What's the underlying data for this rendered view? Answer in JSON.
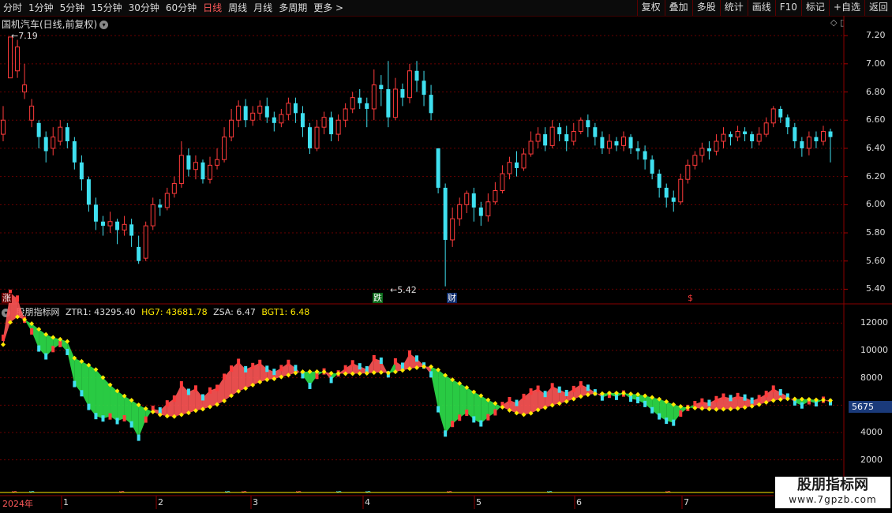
{
  "toolbar": {
    "left": [
      "分时",
      "1分钟",
      "5分钟",
      "15分钟",
      "30分钟",
      "60分钟",
      "日线",
      "周线",
      "月线",
      "多周期",
      "更多 >"
    ],
    "active_index": 6,
    "right": [
      "复权",
      "叠加",
      "多股",
      "统计",
      "画线",
      "F10",
      "标记",
      "+自选",
      "返回"
    ]
  },
  "chart": {
    "title": "国机汽车(日线,前复权)",
    "high_label": "7.19",
    "low_label": "5.42",
    "price_axis": [
      "7.20",
      "7.00",
      "6.80",
      "6.60",
      "6.40",
      "6.20",
      "6.00",
      "5.80",
      "5.60",
      "5.40"
    ],
    "markers": {
      "rise": "涨",
      "fall": "跌",
      "finance": "财",
      "dollar": "$"
    }
  },
  "indicator": {
    "name": "股朋指标网",
    "ztr1": "ZTR1: 43295.40",
    "hg7": "HG7: 43681.78",
    "zsa": "ZSA: 6.47",
    "bgt1": "BGT1: 6.48",
    "axis": [
      "12000",
      "10000",
      "8000",
      "6000",
      "4000",
      "2000"
    ],
    "current_value": "5675"
  },
  "dates": {
    "year": "2024年",
    "months": [
      "1",
      "2",
      "3",
      "4",
      "5",
      "6",
      "7"
    ]
  },
  "watermark": {
    "line1": "股朋指标网",
    "line2": "www.7gpzb.com"
  },
  "colors": {
    "up": "#ff3b3b",
    "down": "#3fe0f0",
    "yellow": "#ffea00",
    "green": "#2ee04a",
    "grid": "#7a0000"
  },
  "chart_data": {
    "type": "candlestick",
    "y_range": [
      5.38,
      7.24
    ],
    "candles": [
      [
        6.5,
        6.6,
        6.45,
        6.7
      ],
      [
        6.9,
        7.19,
        6.9,
        7.15
      ],
      [
        6.95,
        7.12,
        6.9,
        7.17
      ],
      [
        6.8,
        6.85,
        6.75,
        7.0
      ],
      [
        6.6,
        6.7,
        6.55,
        6.75
      ],
      [
        6.58,
        6.48,
        6.4,
        6.6
      ],
      [
        6.48,
        6.38,
        6.3,
        6.52
      ],
      [
        6.4,
        6.48,
        6.35,
        6.55
      ],
      [
        6.45,
        6.55,
        6.42,
        6.6
      ],
      [
        6.55,
        6.45,
        6.4,
        6.58
      ],
      [
        6.45,
        6.3,
        6.25,
        6.48
      ],
      [
        6.3,
        6.18,
        6.1,
        6.35
      ],
      [
        6.18,
        6.0,
        5.95,
        6.2
      ],
      [
        6.0,
        5.88,
        5.82,
        6.05
      ],
      [
        5.88,
        5.85,
        5.78,
        5.92
      ],
      [
        5.85,
        5.88,
        5.8,
        5.95
      ],
      [
        5.88,
        5.82,
        5.72,
        5.9
      ],
      [
        5.82,
        5.86,
        5.78,
        5.92
      ],
      [
        5.86,
        5.78,
        5.7,
        5.9
      ],
      [
        5.7,
        5.6,
        5.58,
        5.78
      ],
      [
        5.62,
        5.85,
        5.6,
        5.88
      ],
      [
        5.85,
        6.0,
        5.82,
        6.05
      ],
      [
        6.0,
        5.98,
        5.92,
        6.04
      ],
      [
        5.98,
        6.08,
        5.96,
        6.12
      ],
      [
        6.08,
        6.15,
        6.05,
        6.2
      ],
      [
        6.15,
        6.35,
        6.12,
        6.45
      ],
      [
        6.35,
        6.25,
        6.2,
        6.4
      ],
      [
        6.25,
        6.3,
        6.18,
        6.35
      ],
      [
        6.3,
        6.18,
        6.15,
        6.32
      ],
      [
        6.18,
        6.28,
        6.15,
        6.34
      ],
      [
        6.28,
        6.32,
        6.25,
        6.4
      ],
      [
        6.32,
        6.48,
        6.3,
        6.55
      ],
      [
        6.48,
        6.6,
        6.45,
        6.68
      ],
      [
        6.6,
        6.7,
        6.55,
        6.74
      ],
      [
        6.7,
        6.6,
        6.55,
        6.75
      ],
      [
        6.6,
        6.65,
        6.56,
        6.7
      ],
      [
        6.65,
        6.7,
        6.6,
        6.74
      ],
      [
        6.7,
        6.62,
        6.58,
        6.76
      ],
      [
        6.62,
        6.58,
        6.52,
        6.66
      ],
      [
        6.58,
        6.64,
        6.55,
        6.68
      ],
      [
        6.64,
        6.72,
        6.6,
        6.76
      ],
      [
        6.72,
        6.65,
        6.58,
        6.76
      ],
      [
        6.65,
        6.55,
        6.48,
        6.7
      ],
      [
        6.55,
        6.4,
        6.36,
        6.58
      ],
      [
        6.4,
        6.55,
        6.38,
        6.6
      ],
      [
        6.55,
        6.62,
        6.5,
        6.66
      ],
      [
        6.62,
        6.5,
        6.45,
        6.66
      ],
      [
        6.5,
        6.6,
        6.45,
        6.64
      ],
      [
        6.6,
        6.68,
        6.55,
        6.72
      ],
      [
        6.68,
        6.76,
        6.65,
        6.8
      ],
      [
        6.76,
        6.72,
        6.68,
        6.82
      ],
      [
        6.72,
        6.68,
        6.55,
        6.76
      ],
      [
        6.68,
        6.85,
        6.6,
        6.96
      ],
      [
        6.85,
        6.82,
        6.7,
        6.92
      ],
      [
        6.82,
        6.62,
        6.55,
        7.02
      ],
      [
        6.62,
        6.82,
        6.6,
        6.9
      ],
      [
        6.82,
        6.76,
        6.7,
        6.86
      ],
      [
        6.76,
        6.95,
        6.72,
        7.0
      ],
      [
        6.95,
        6.88,
        6.8,
        7.02
      ],
      [
        6.88,
        6.78,
        6.7,
        6.95
      ],
      [
        6.78,
        6.65,
        6.6,
        6.85
      ],
      [
        6.4,
        6.12,
        6.08,
        6.32
      ],
      [
        6.12,
        5.75,
        5.42,
        6.15
      ],
      [
        5.75,
        5.9,
        5.7,
        5.98
      ],
      [
        5.9,
        6.0,
        5.85,
        6.05
      ],
      [
        6.0,
        6.08,
        5.94,
        6.1
      ],
      [
        6.08,
        5.98,
        5.88,
        6.12
      ],
      [
        5.98,
        5.92,
        5.85,
        6.02
      ],
      [
        5.92,
        6.02,
        5.88,
        6.08
      ],
      [
        6.02,
        6.1,
        6.0,
        6.16
      ],
      [
        6.1,
        6.22,
        6.08,
        6.28
      ],
      [
        6.22,
        6.3,
        6.18,
        6.34
      ],
      [
        6.3,
        6.26,
        6.2,
        6.38
      ],
      [
        6.26,
        6.36,
        6.24,
        6.4
      ],
      [
        6.36,
        6.45,
        6.34,
        6.52
      ],
      [
        6.45,
        6.5,
        6.4,
        6.55
      ],
      [
        6.5,
        6.42,
        6.38,
        6.55
      ],
      [
        6.42,
        6.55,
        6.4,
        6.6
      ],
      [
        6.55,
        6.5,
        6.45,
        6.58
      ],
      [
        6.5,
        6.45,
        6.38,
        6.56
      ],
      [
        6.45,
        6.52,
        6.42,
        6.58
      ],
      [
        6.52,
        6.6,
        6.5,
        6.62
      ],
      [
        6.6,
        6.55,
        6.48,
        6.64
      ],
      [
        6.55,
        6.48,
        6.42,
        6.58
      ],
      [
        6.48,
        6.4,
        6.36,
        6.52
      ],
      [
        6.4,
        6.45,
        6.36,
        6.5
      ],
      [
        6.45,
        6.42,
        6.38,
        6.48
      ],
      [
        6.42,
        6.48,
        6.38,
        6.52
      ],
      [
        6.48,
        6.4,
        6.36,
        6.5
      ],
      [
        6.4,
        6.38,
        6.32,
        6.45
      ],
      [
        6.38,
        6.32,
        6.25,
        6.42
      ],
      [
        6.32,
        6.22,
        6.18,
        6.35
      ],
      [
        6.22,
        6.12,
        6.05,
        6.25
      ],
      [
        6.12,
        6.05,
        5.98,
        6.15
      ],
      [
        6.05,
        6.02,
        5.95,
        6.1
      ],
      [
        6.02,
        6.18,
        6.0,
        6.22
      ],
      [
        6.18,
        6.28,
        6.15,
        6.32
      ],
      [
        6.28,
        6.35,
        6.25,
        6.38
      ],
      [
        6.35,
        6.4,
        6.3,
        6.44
      ],
      [
        6.4,
        6.38,
        6.32,
        6.45
      ],
      [
        6.38,
        6.45,
        6.35,
        6.5
      ],
      [
        6.45,
        6.5,
        6.4,
        6.55
      ],
      [
        6.5,
        6.48,
        6.42,
        6.52
      ],
      [
        6.48,
        6.52,
        6.45,
        6.56
      ],
      [
        6.52,
        6.5,
        6.45,
        6.55
      ],
      [
        6.5,
        6.45,
        6.4,
        6.52
      ],
      [
        6.45,
        6.5,
        6.42,
        6.55
      ],
      [
        6.5,
        6.58,
        6.48,
        6.62
      ],
      [
        6.58,
        6.68,
        6.55,
        6.7
      ],
      [
        6.68,
        6.62,
        6.58,
        6.7
      ],
      [
        6.62,
        6.55,
        6.5,
        6.64
      ],
      [
        6.55,
        6.45,
        6.4,
        6.58
      ],
      [
        6.45,
        6.4,
        6.34,
        6.48
      ],
      [
        6.4,
        6.48,
        6.35,
        6.52
      ],
      [
        6.48,
        6.45,
        6.4,
        6.52
      ],
      [
        6.45,
        6.52,
        6.42,
        6.56
      ],
      [
        6.52,
        6.48,
        6.3,
        6.54
      ]
    ],
    "indicator_range": [
      1000,
      13000
    ]
  }
}
